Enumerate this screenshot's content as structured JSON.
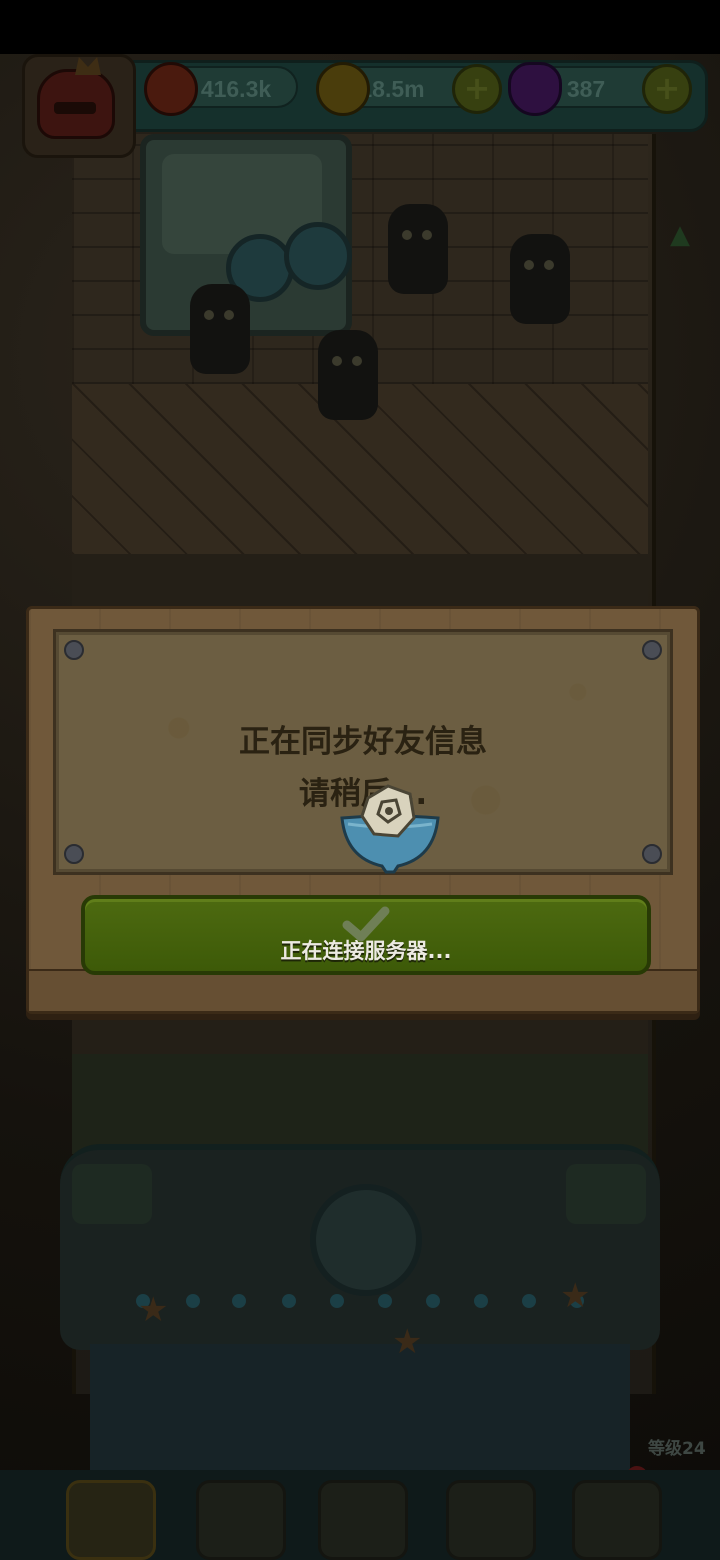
{
  "hud": {
    "eyeballs": "416.3k",
    "coins": "18.5m",
    "potions": "387",
    "plus_symbol": "+"
  },
  "dialog": {
    "message_line1": "正在同步好友信息",
    "message_line2": "请稍后...",
    "button_status": "正在连接服务器..."
  },
  "level": {
    "label": "等级24"
  },
  "colors": {
    "accent_green": "#4d6a10",
    "wood": "#70583a",
    "parchment": "#6c5e42"
  }
}
